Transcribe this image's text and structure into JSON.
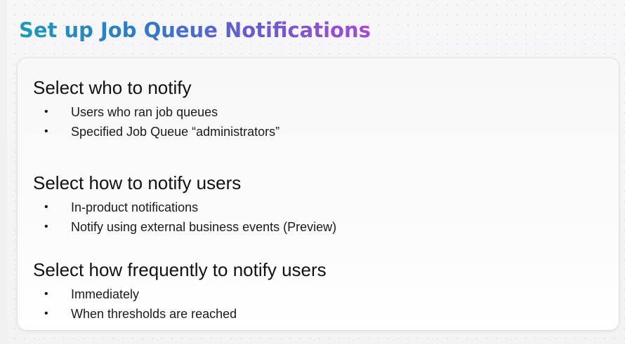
{
  "slide": {
    "title": "Set up Job Queue Notifications",
    "title_gradient": [
      "#1e9bb4",
      "#2f7cc4",
      "#6a5ad0",
      "#a64bd0"
    ],
    "sections": [
      {
        "heading": "Select who to notify",
        "bullets": [
          "Users who ran job queues",
          "Specified Job Queue “administrators”"
        ]
      },
      {
        "heading": "Select how to notify users",
        "bullets": [
          "In-product notifications",
          "Notify using external business events (Preview)"
        ]
      },
      {
        "heading": "Select how frequently to notify users",
        "bullets": [
          "Immediately",
          "When thresholds are reached"
        ]
      }
    ]
  }
}
